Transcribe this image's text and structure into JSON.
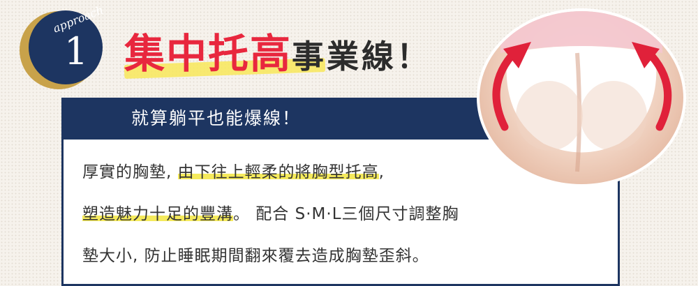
{
  "badge": {
    "word": "approach",
    "number": "1"
  },
  "title": {
    "main": "集中托高",
    "sub": "事業線！"
  },
  "panel": {
    "header": "就算躺平也能爆線！",
    "lines": [
      {
        "pre": "厚實的胸墊, ",
        "highlight": "由下往上輕柔的將胸型托高",
        "post": ", "
      },
      {
        "pre": "",
        "highlight": "塑造魅力十足的豐溝",
        "post": "。 配合 S·M·L三個尺寸調整胸"
      },
      {
        "pre": "墊大小, 防止睡眠期間翻來覆去造成胸墊歪斜。",
        "highlight": "",
        "post": ""
      }
    ]
  },
  "colors": {
    "navy": "#1d3561",
    "gold": "#c8a24a",
    "red": "#e8273e",
    "highlight": "#f5ea5c",
    "arrow": "#e0213a"
  },
  "icons": {
    "arrows": "curved-red-arrow-icon"
  }
}
